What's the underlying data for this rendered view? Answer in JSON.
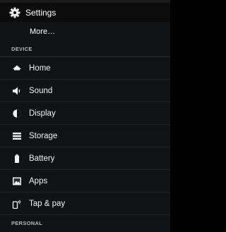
{
  "header": {
    "title": "Settings",
    "icon": "gear-icon"
  },
  "more_label": "More…",
  "sections": {
    "device": "DEVICE",
    "personal": "PERSONAL"
  },
  "items": [
    {
      "label": "Home",
      "icon": "home-icon"
    },
    {
      "label": "Sound",
      "icon": "speaker-icon"
    },
    {
      "label": "Display",
      "icon": "brightness-icon"
    },
    {
      "label": "Storage",
      "icon": "storage-icon"
    },
    {
      "label": "Battery",
      "icon": "battery-icon"
    },
    {
      "label": "Apps",
      "icon": "apps-icon"
    },
    {
      "label": "Tap & pay",
      "icon": "tap-pay-icon"
    }
  ]
}
